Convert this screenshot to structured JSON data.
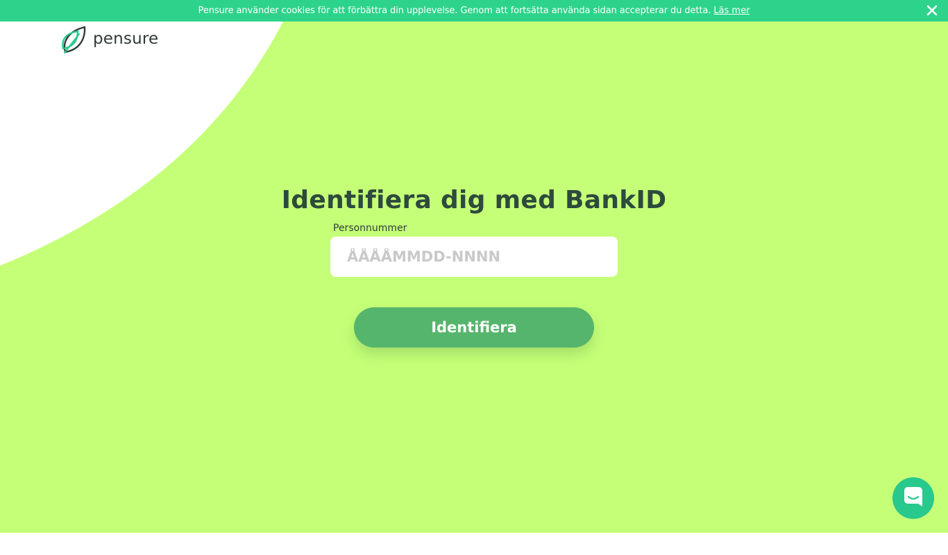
{
  "cookie_banner": {
    "message": "Pensure använder cookies för att förbättra din upplevelse. Genom att fortsätta använda sidan accepterar du detta.",
    "link_text": "Läs mer",
    "close_icon": "close-icon"
  },
  "brand": {
    "name": "pensure",
    "logo_icon": "leaf-icon"
  },
  "login": {
    "title": "Identifiera dig med BankID",
    "field_label": "Personnummer",
    "field_placeholder": "ÅÅÅÅMMDD-NNNN",
    "field_value": "",
    "submit_label": "Identifiera"
  },
  "chat": {
    "icon": "chat-icon"
  },
  "colors": {
    "cookie_bar": "#2dd38a",
    "hero_background": "#c5ff78",
    "button": "#56b56c",
    "title_text": "#2d4a3c",
    "chat_launcher": "#27c98c"
  }
}
